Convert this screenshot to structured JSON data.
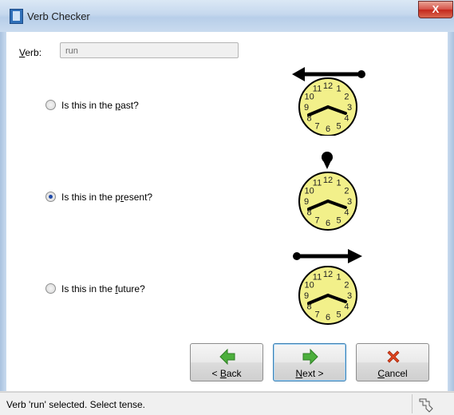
{
  "window": {
    "title": "Verb Checker",
    "close_label": "X"
  },
  "verb": {
    "label_prefix": "",
    "label_accel": "V",
    "label_rest": "erb:",
    "value": "run"
  },
  "options": [
    {
      "pre": "Is this in the ",
      "accel": "p",
      "post": "ast?",
      "selected": false,
      "clock_icon": "clock-past-icon"
    },
    {
      "pre": "Is this in the p",
      "accel": "r",
      "post": "esent?",
      "selected": true,
      "clock_icon": "clock-present-icon"
    },
    {
      "pre": "Is this in the ",
      "accel": "f",
      "post": "uture?",
      "selected": false,
      "clock_icon": "clock-future-icon"
    }
  ],
  "clock": {
    "numbers": [
      "12",
      "1",
      "2",
      "3",
      "4",
      "5",
      "6",
      "7",
      "8",
      "9",
      "10",
      "11"
    ],
    "face_color": "#f2f08a"
  },
  "buttons": {
    "back": {
      "pre": "< ",
      "accel": "B",
      "post": "ack",
      "icon": "arrow-left-icon",
      "color": "#4caf3c"
    },
    "next": {
      "pre": "",
      "accel": "N",
      "post": "ext >",
      "icon": "arrow-right-icon",
      "color": "#4caf3c"
    },
    "cancel": {
      "pre": "",
      "accel": "C",
      "post": "ancel",
      "icon": "x-mark-icon",
      "color": "#e0451f"
    }
  },
  "status": {
    "text": "Verb 'run' selected. Select tense."
  }
}
